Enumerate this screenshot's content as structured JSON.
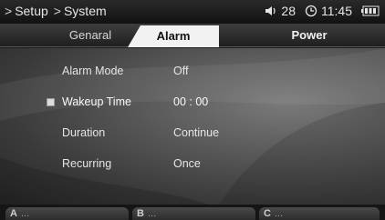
{
  "titlebar": {
    "breadcrumb": [
      "Setup",
      "System"
    ],
    "breadcrumb_separator": ">",
    "volume": "28",
    "time": "11:45",
    "icons": [
      "speaker-icon",
      "clock-icon",
      "battery-icon"
    ]
  },
  "tabs": [
    {
      "label": "Genaral",
      "active": false
    },
    {
      "label": "Alarm",
      "active": true
    },
    {
      "label": "Power",
      "active": false
    }
  ],
  "settings": [
    {
      "label": "Alarm Mode",
      "value": "Off",
      "selected": false
    },
    {
      "label": "Wakeup Time",
      "value": "00 : 00",
      "selected": true
    },
    {
      "label": "Duration",
      "value": "Continue",
      "selected": false
    },
    {
      "label": "Recurring",
      "value": "Once",
      "selected": false
    }
  ],
  "softkeys": [
    {
      "key": "A",
      "dots": "..."
    },
    {
      "key": "B",
      "dots": "..."
    },
    {
      "key": "C",
      "dots": "..."
    }
  ],
  "colors": {
    "active_tab": "#f2f2f2",
    "text": "#e6e6e6"
  }
}
